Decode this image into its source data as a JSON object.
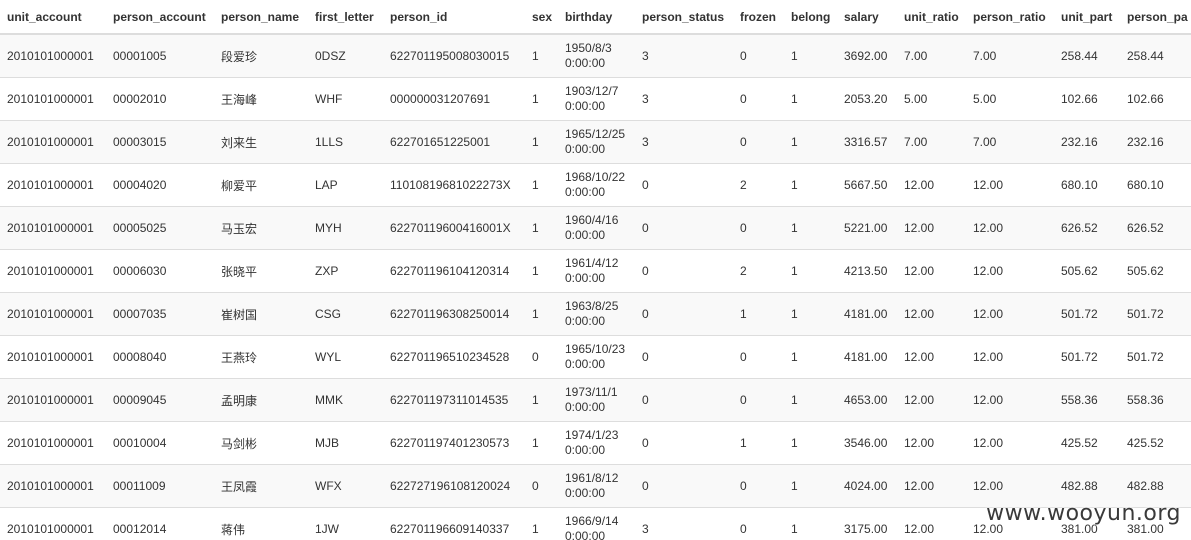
{
  "table": {
    "columns": [
      "unit_account",
      "person_account",
      "person_name",
      "first_letter",
      "person_id",
      "sex",
      "birthday",
      "person_status",
      "frozen",
      "belong",
      "salary",
      "unit_ratio",
      "person_ratio",
      "unit_part",
      "person_pa"
    ],
    "rows": [
      {
        "unit_account": "2010101000001",
        "person_account": "00001005",
        "person_name": "段爱珍",
        "first_letter": "0DSZ",
        "person_id": "622701195008030015",
        "sex": "1",
        "birthday_date": "1950/8/3",
        "birthday_time": "0:00:00",
        "person_status": "3",
        "frozen": "0",
        "belong": "1",
        "salary": "3692.00",
        "unit_ratio": "7.00",
        "person_ratio": "7.00",
        "unit_part": "258.44",
        "person_part": "258.44"
      },
      {
        "unit_account": "2010101000001",
        "person_account": "00002010",
        "person_name": "王海峰",
        "first_letter": "WHF",
        "person_id": "000000031207691",
        "sex": "1",
        "birthday_date": "1903/12/7",
        "birthday_time": "0:00:00",
        "person_status": "3",
        "frozen": "0",
        "belong": "1",
        "salary": "2053.20",
        "unit_ratio": "5.00",
        "person_ratio": "5.00",
        "unit_part": "102.66",
        "person_part": "102.66"
      },
      {
        "unit_account": "2010101000001",
        "person_account": "00003015",
        "person_name": "刘来生",
        "first_letter": "1LLS",
        "person_id": "622701651225001",
        "sex": "1",
        "birthday_date": "1965/12/25",
        "birthday_time": "0:00:00",
        "person_status": "3",
        "frozen": "0",
        "belong": "1",
        "salary": "3316.57",
        "unit_ratio": "7.00",
        "person_ratio": "7.00",
        "unit_part": "232.16",
        "person_part": "232.16"
      },
      {
        "unit_account": "2010101000001",
        "person_account": "00004020",
        "person_name": "柳爱平",
        "first_letter": "LAP",
        "person_id": "11010819681022273X",
        "sex": "1",
        "birthday_date": "1968/10/22",
        "birthday_time": "0:00:00",
        "person_status": "0",
        "frozen": "2",
        "belong": "1",
        "salary": "5667.50",
        "unit_ratio": "12.00",
        "person_ratio": "12.00",
        "unit_part": "680.10",
        "person_part": "680.10"
      },
      {
        "unit_account": "2010101000001",
        "person_account": "00005025",
        "person_name": "马玉宏",
        "first_letter": "MYH",
        "person_id": "62270119600416001X",
        "sex": "1",
        "birthday_date": "1960/4/16",
        "birthday_time": "0:00:00",
        "person_status": "0",
        "frozen": "0",
        "belong": "1",
        "salary": "5221.00",
        "unit_ratio": "12.00",
        "person_ratio": "12.00",
        "unit_part": "626.52",
        "person_part": "626.52"
      },
      {
        "unit_account": "2010101000001",
        "person_account": "00006030",
        "person_name": "张晓平",
        "first_letter": "ZXP",
        "person_id": "622701196104120314",
        "sex": "1",
        "birthday_date": "1961/4/12",
        "birthday_time": "0:00:00",
        "person_status": "0",
        "frozen": "2",
        "belong": "1",
        "salary": "4213.50",
        "unit_ratio": "12.00",
        "person_ratio": "12.00",
        "unit_part": "505.62",
        "person_part": "505.62"
      },
      {
        "unit_account": "2010101000001",
        "person_account": "00007035",
        "person_name": "崔树国",
        "first_letter": "CSG",
        "person_id": "622701196308250014",
        "sex": "1",
        "birthday_date": "1963/8/25",
        "birthday_time": "0:00:00",
        "person_status": "0",
        "frozen": "1",
        "belong": "1",
        "salary": "4181.00",
        "unit_ratio": "12.00",
        "person_ratio": "12.00",
        "unit_part": "501.72",
        "person_part": "501.72"
      },
      {
        "unit_account": "2010101000001",
        "person_account": "00008040",
        "person_name": "王燕玲",
        "first_letter": "WYL",
        "person_id": "622701196510234528",
        "sex": "0",
        "birthday_date": "1965/10/23",
        "birthday_time": "0:00:00",
        "person_status": "0",
        "frozen": "0",
        "belong": "1",
        "salary": "4181.00",
        "unit_ratio": "12.00",
        "person_ratio": "12.00",
        "unit_part": "501.72",
        "person_part": "501.72"
      },
      {
        "unit_account": "2010101000001",
        "person_account": "00009045",
        "person_name": "孟明康",
        "first_letter": "MMK",
        "person_id": "622701197311014535",
        "sex": "1",
        "birthday_date": "1973/11/1",
        "birthday_time": "0:00:00",
        "person_status": "0",
        "frozen": "0",
        "belong": "1",
        "salary": "4653.00",
        "unit_ratio": "12.00",
        "person_ratio": "12.00",
        "unit_part": "558.36",
        "person_part": "558.36"
      },
      {
        "unit_account": "2010101000001",
        "person_account": "00010004",
        "person_name": "马剑彬",
        "first_letter": "MJB",
        "person_id": "622701197401230573",
        "sex": "1",
        "birthday_date": "1974/1/23",
        "birthday_time": "0:00:00",
        "person_status": "0",
        "frozen": "1",
        "belong": "1",
        "salary": "3546.00",
        "unit_ratio": "12.00",
        "person_ratio": "12.00",
        "unit_part": "425.52",
        "person_part": "425.52"
      },
      {
        "unit_account": "2010101000001",
        "person_account": "00011009",
        "person_name": "王凤霞",
        "first_letter": "WFX",
        "person_id": "622727196108120024",
        "sex": "0",
        "birthday_date": "1961/8/12",
        "birthday_time": "0:00:00",
        "person_status": "0",
        "frozen": "0",
        "belong": "1",
        "salary": "4024.00",
        "unit_ratio": "12.00",
        "person_ratio": "12.00",
        "unit_part": "482.88",
        "person_part": "482.88"
      },
      {
        "unit_account": "2010101000001",
        "person_account": "00012014",
        "person_name": "蒋伟",
        "first_letter": "1JW",
        "person_id": "622701196609140337",
        "sex": "1",
        "birthday_date": "1966/9/14",
        "birthday_time": "0:00:00",
        "person_status": "3",
        "frozen": "0",
        "belong": "1",
        "salary": "3175.00",
        "unit_ratio": "12.00",
        "person_ratio": "12.00",
        "unit_part": "381.00",
        "person_part": "381.00"
      }
    ]
  },
  "watermark": "www.wooyun.org"
}
